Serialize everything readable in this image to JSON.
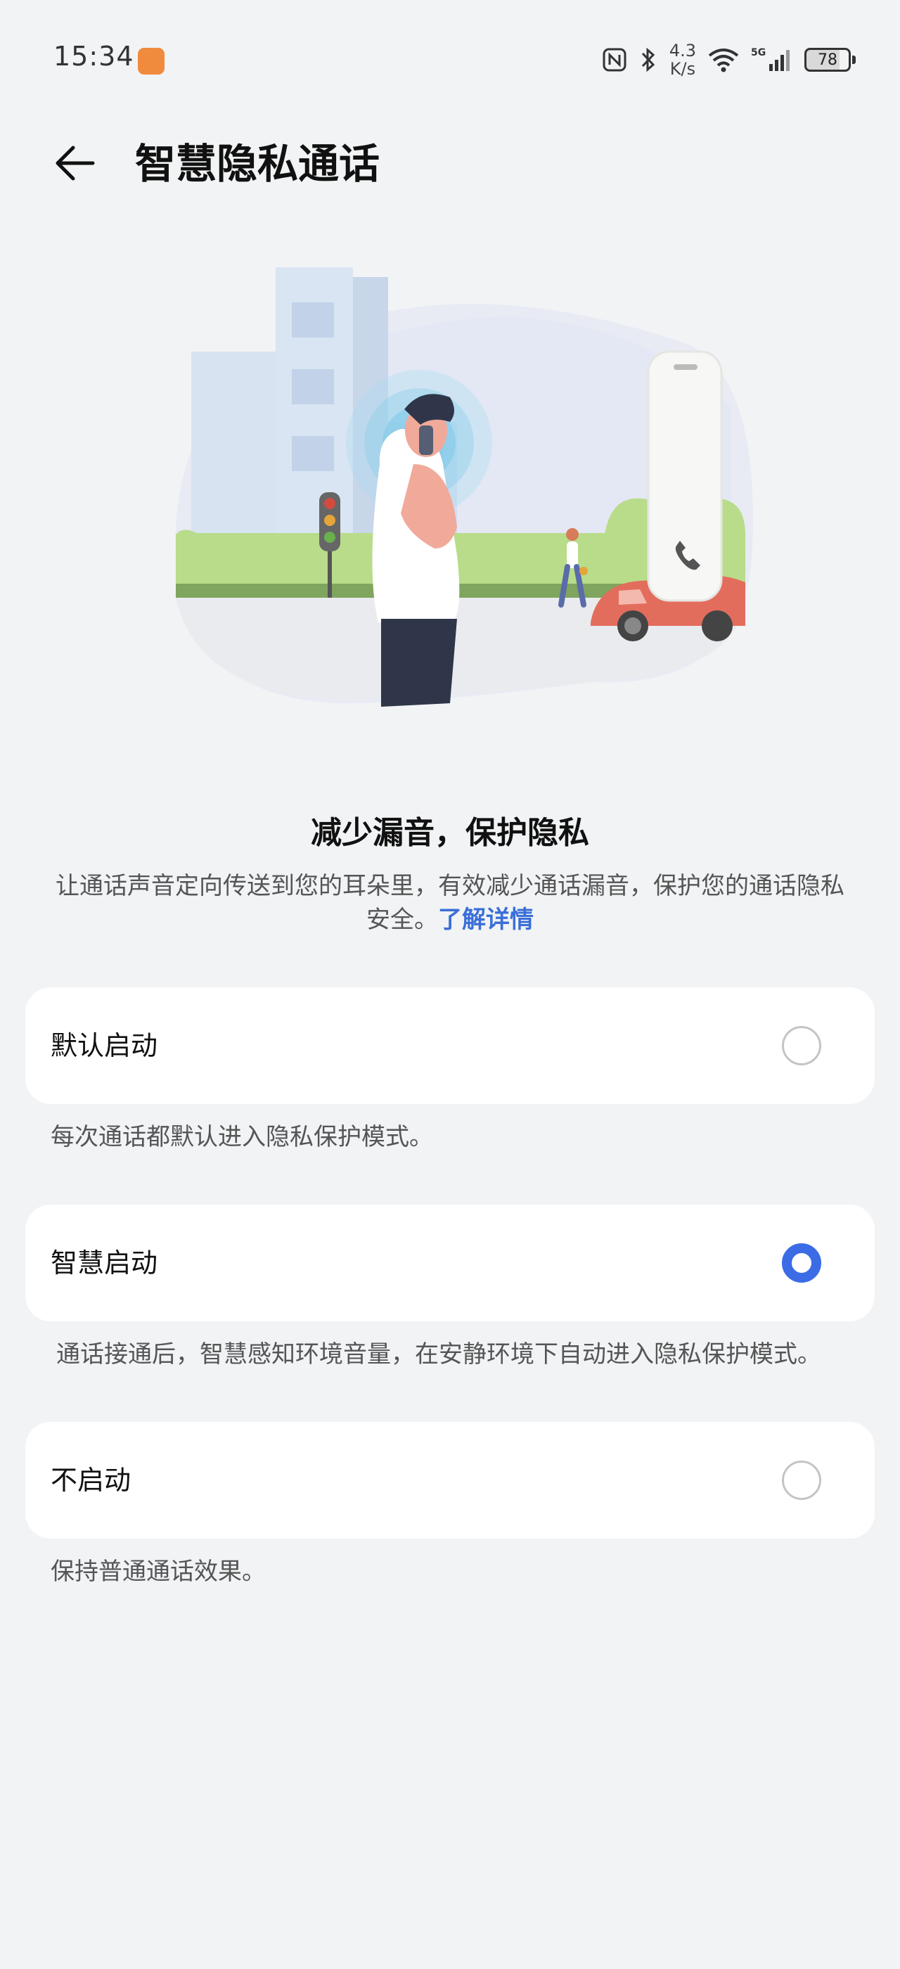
{
  "status_bar": {
    "time": "15:34",
    "net_speed_value": "4.3",
    "net_speed_unit": "K/s",
    "battery": "78",
    "icons": [
      "notification-app-icon",
      "nfc-icon",
      "bluetooth-icon",
      "wifi-icon",
      "signal-5g-icon",
      "battery-icon"
    ]
  },
  "header": {
    "title": "智慧隐私通话",
    "back_icon": "arrow-left-icon"
  },
  "intro": {
    "title": "减少漏音，保护隐私",
    "description": "让通话声音定向传送到您的耳朵里，有效减少通话漏音，保护您的通话隐私安全。",
    "link": "了解详情"
  },
  "options": [
    {
      "label": "默认启动",
      "description": "每次通话都默认进入隐私保护模式。",
      "selected": false
    },
    {
      "label": "智慧启动",
      "description": "通话接通后，智慧感知环境音量，在安静环境下自动进入隐私保护模式。",
      "selected": true
    },
    {
      "label": "不启动",
      "description": "保持普通通话效果。",
      "selected": false
    }
  ],
  "colors": {
    "background": "#f1f3f5",
    "accent": "#3b6ce6",
    "link": "#3a6fd8",
    "card": "#ffffff"
  }
}
